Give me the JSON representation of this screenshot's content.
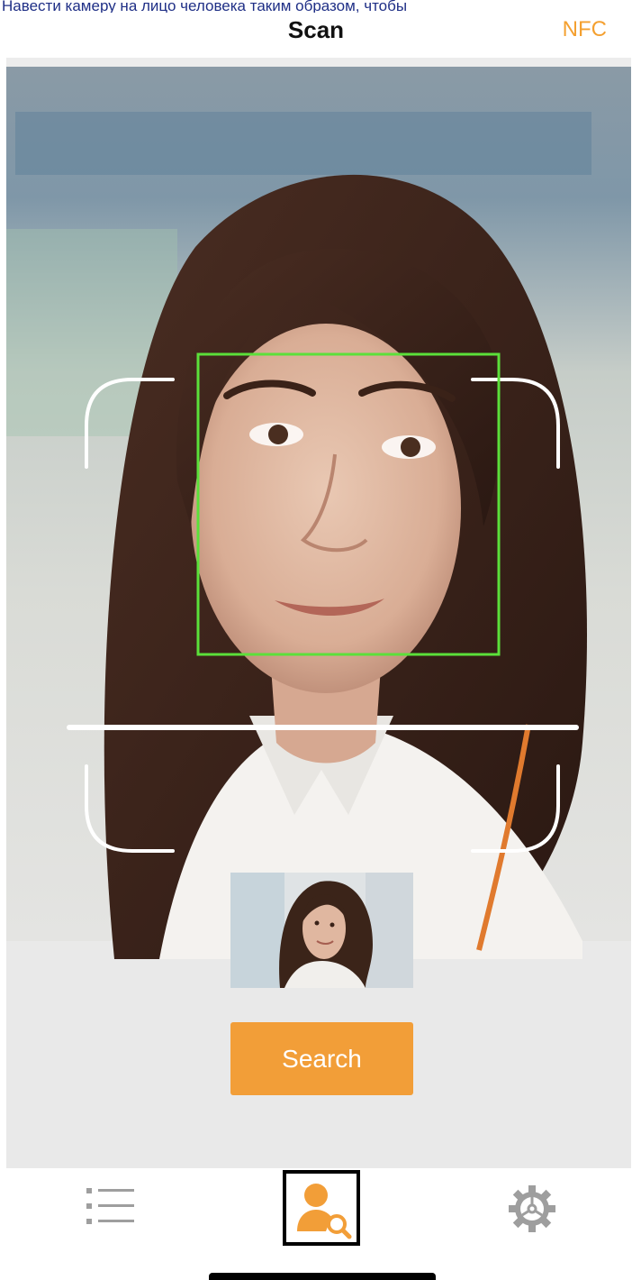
{
  "caption": "Навести камеру на лицо человека таким образом, чтобы",
  "nav": {
    "title": "Scan",
    "nfc_label": "NFC"
  },
  "scan": {
    "search_label": "Search"
  },
  "icons": {
    "list": "list-icon",
    "scan": "face-search-icon",
    "settings": "gear-icon"
  },
  "colors": {
    "accent": "#f29e38",
    "face_box": "#5be03a",
    "nfc": "#f4a030",
    "tab_inactive": "#9e9e9e"
  }
}
